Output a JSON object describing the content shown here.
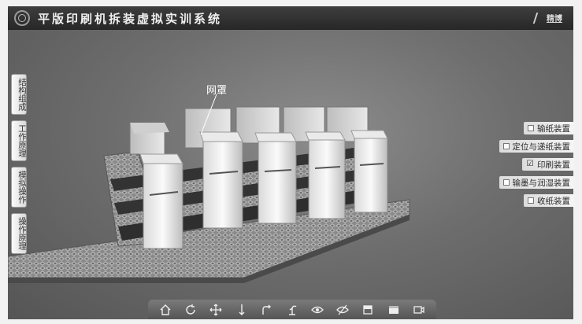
{
  "app": {
    "title": "平版印刷机拆装虚拟实训系统",
    "brand": "精博"
  },
  "left_nav": [
    {
      "label": "结构组成"
    },
    {
      "label": "工作原理"
    },
    {
      "label": "模拟操作"
    },
    {
      "label": "操作原理"
    }
  ],
  "right_panel": {
    "options": [
      {
        "label": "输纸装置",
        "checked": false
      },
      {
        "label": "定位与递纸装置",
        "checked": false
      },
      {
        "label": "印刷装置",
        "checked": true
      },
      {
        "label": "输墨与润湿装置",
        "checked": false
      },
      {
        "label": "收纸装置",
        "checked": false
      }
    ]
  },
  "scene": {
    "annotation": "网罩"
  },
  "toolbar": {
    "icons": [
      "home-icon",
      "rotate-icon",
      "pan-icon",
      "vertical-move-icon",
      "return-icon",
      "lamp-icon",
      "show-icon",
      "hide-icon",
      "panel-icon",
      "window-icon",
      "camera-icon"
    ]
  },
  "colors": {
    "titlebar": "#2f2f2f",
    "background": "#6e6e6e"
  }
}
